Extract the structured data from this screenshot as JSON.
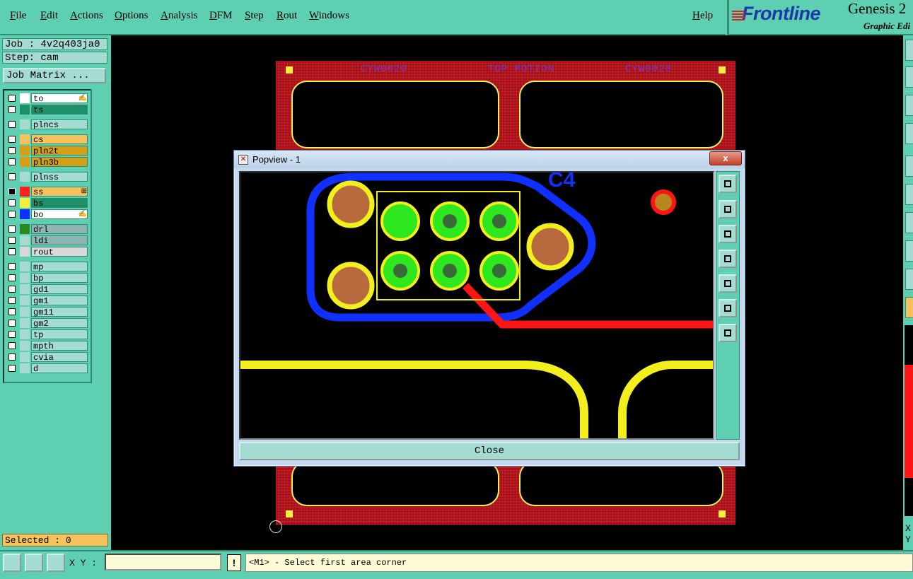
{
  "menu": [
    "File",
    "Edit",
    "Actions",
    "Options",
    "Analysis",
    "DFM",
    "Step",
    "Rout",
    "Windows"
  ],
  "help_label": "Help",
  "brand": {
    "logo": "Frontline",
    "product": "Genesis 2",
    "subtitle": "Graphic Edi"
  },
  "job": {
    "job_line": "Job : 4v2q403ja0",
    "step_line": "Step: cam",
    "matrix_button": "Job Matrix ..."
  },
  "layers": [
    {
      "name": "to",
      "color": "#ffffff",
      "bg": "#ffffff",
      "active": false,
      "mark": "✍"
    },
    {
      "name": "ts",
      "color": "#1f8f6a",
      "bg": "#1f8f6a",
      "active": false,
      "mark": ""
    },
    {
      "name": "plncs",
      "color": "#a4dcd1",
      "bg": "#a4dcd1",
      "active": false,
      "mark": ""
    },
    {
      "name": "cs",
      "color": "#f6c25e",
      "bg": "#f6c25e",
      "active": false,
      "mark": ""
    },
    {
      "name": "pln2t",
      "color": "#d4a017",
      "bg": "#d4a017",
      "active": false,
      "mark": ""
    },
    {
      "name": "pln3b",
      "color": "#d4a017",
      "bg": "#d4a017",
      "active": false,
      "mark": ""
    },
    {
      "name": "plnss",
      "color": "#a4dcd1",
      "bg": "#a4dcd1",
      "active": false,
      "mark": ""
    },
    {
      "name": "ss",
      "color": "#ff2020",
      "bg": "#f6c25e",
      "active": true,
      "mark": "⊞"
    },
    {
      "name": "bs",
      "color": "#f3ef3e",
      "bg": "#1f8f6a",
      "active": false,
      "mark": ""
    },
    {
      "name": "bo",
      "color": "#1030ff",
      "bg": "#ffffff",
      "active": false,
      "mark": "✍"
    },
    {
      "name": "drl",
      "color": "#2a8a22",
      "bg": "#8fb4b4",
      "active": false,
      "mark": ""
    },
    {
      "name": "ldi",
      "color": "#a4dcd1",
      "bg": "#8fb4b4",
      "active": false,
      "mark": ""
    },
    {
      "name": "rout",
      "color": "#d8d8d8",
      "bg": "#d8d8d8",
      "active": false,
      "mark": ""
    },
    {
      "name": "mp",
      "color": "#a4dcd1",
      "bg": "#a4dcd1",
      "active": false,
      "mark": ""
    },
    {
      "name": "bp",
      "color": "#a4dcd1",
      "bg": "#a4dcd1",
      "active": false,
      "mark": ""
    },
    {
      "name": "gd1",
      "color": "#a4dcd1",
      "bg": "#a4dcd1",
      "active": false,
      "mark": ""
    },
    {
      "name": "gm1",
      "color": "#a4dcd1",
      "bg": "#a4dcd1",
      "active": false,
      "mark": ""
    },
    {
      "name": "gm11",
      "color": "#a4dcd1",
      "bg": "#a4dcd1",
      "active": false,
      "mark": ""
    },
    {
      "name": "gm2",
      "color": "#a4dcd1",
      "bg": "#a4dcd1",
      "active": false,
      "mark": ""
    },
    {
      "name": "tp",
      "color": "#a4dcd1",
      "bg": "#a4dcd1",
      "active": false,
      "mark": ""
    },
    {
      "name": "mpth",
      "color": "#a4dcd1",
      "bg": "#a4dcd1",
      "active": false,
      "mark": ""
    },
    {
      "name": "cvia",
      "color": "#a4dcd1",
      "bg": "#a4dcd1",
      "active": false,
      "mark": ""
    },
    {
      "name": "d",
      "color": "#a4dcd1",
      "bg": "#a4dcd1",
      "active": false,
      "mark": ""
    }
  ],
  "selected": "Selected : 0",
  "board_labels": [
    "CYW0020",
    "TOP MOTION",
    "CYW0020"
  ],
  "popview": {
    "title": "Popview - 1",
    "close_label": "Close",
    "close_x": "x",
    "annotation": "C4",
    "side_buttons": [
      "zoom-fit-icon",
      "pan-up-icon",
      "pan-down-icon",
      "pan-left-icon",
      "pan-right-icon",
      "zoom-in-icon",
      "zoom-out-icon"
    ]
  },
  "right_labels": {
    "x": "X",
    "y": "Y"
  },
  "status": {
    "xy_label": "X Y :",
    "xy_value": "",
    "warn": "!",
    "message": "<M1> - Select first area corner"
  },
  "colors": {
    "bg": "#5ecfb1",
    "canvas": "#000000",
    "board": "#8b1a1a",
    "outline": "#1030ff",
    "pad": "#b86a3e",
    "solder": "#2ee81f",
    "trace_red": "#ff1515",
    "trace_yellow": "#f3ef1d"
  }
}
